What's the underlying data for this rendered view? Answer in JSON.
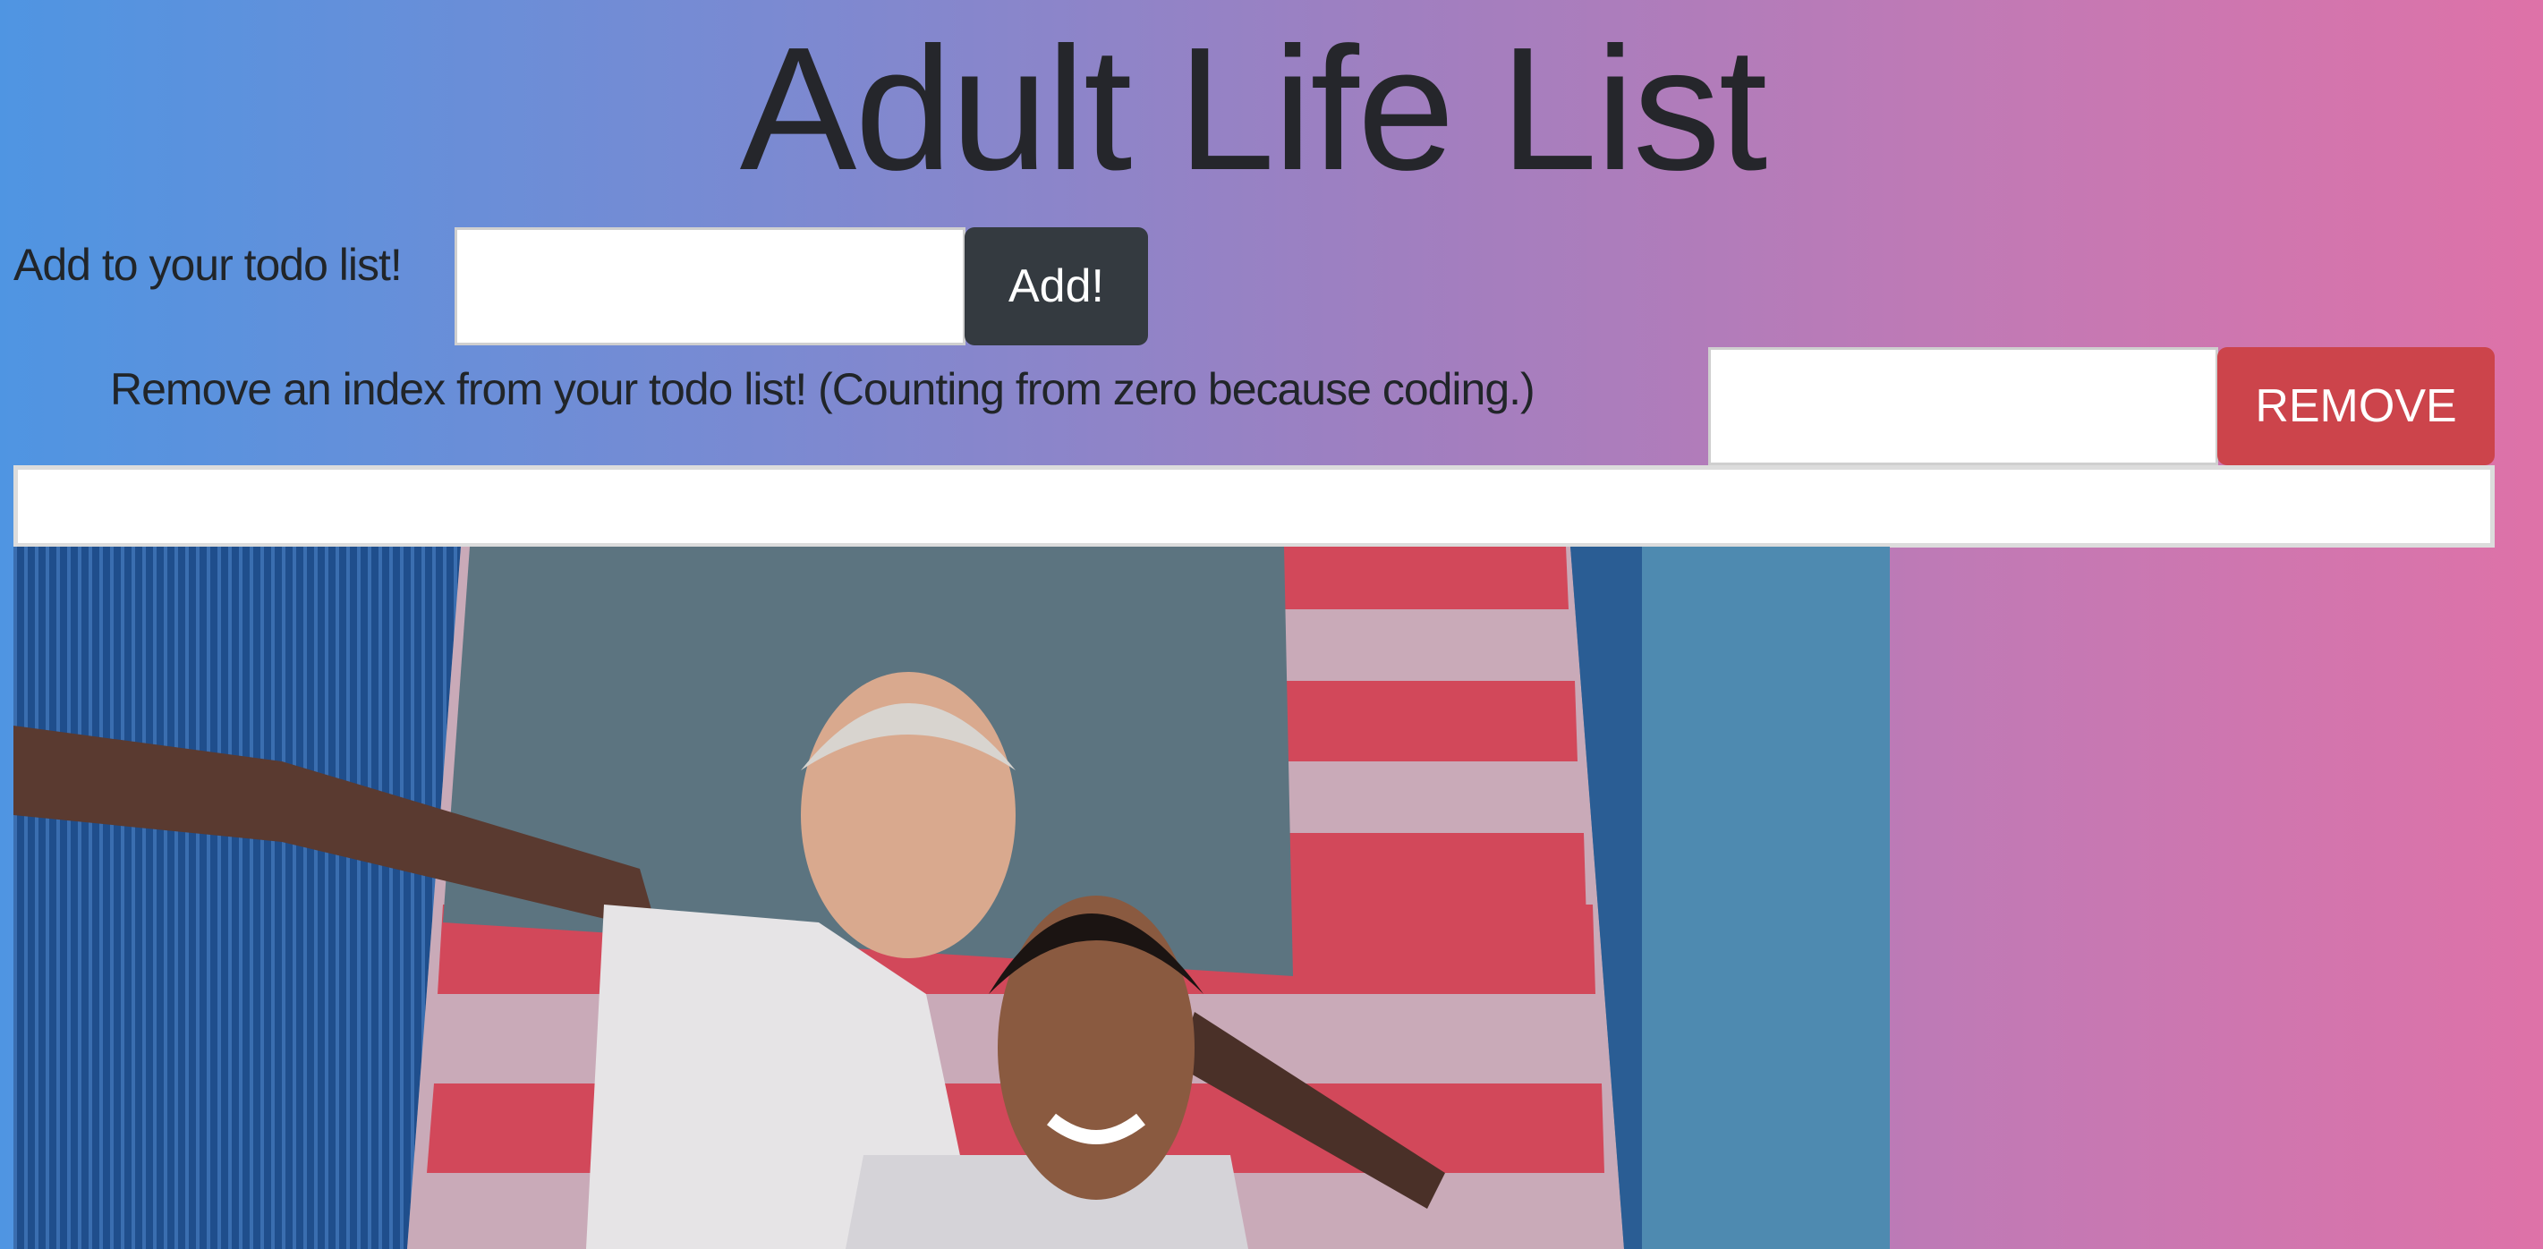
{
  "header": {
    "title": "Adult Life List"
  },
  "add_form": {
    "label": "Add to your todo list!",
    "input_value": "",
    "button_label": "Add!",
    "button_color": "#343a40"
  },
  "remove_form": {
    "label": "Remove an index from your todo list! (Counting from zero because coding.)",
    "input_value": "",
    "button_label": "REMOVE",
    "button_color": "#cc444b"
  },
  "todo_display": {
    "value": ""
  },
  "image": {
    "subject": "two men posing in front of an American flag"
  }
}
